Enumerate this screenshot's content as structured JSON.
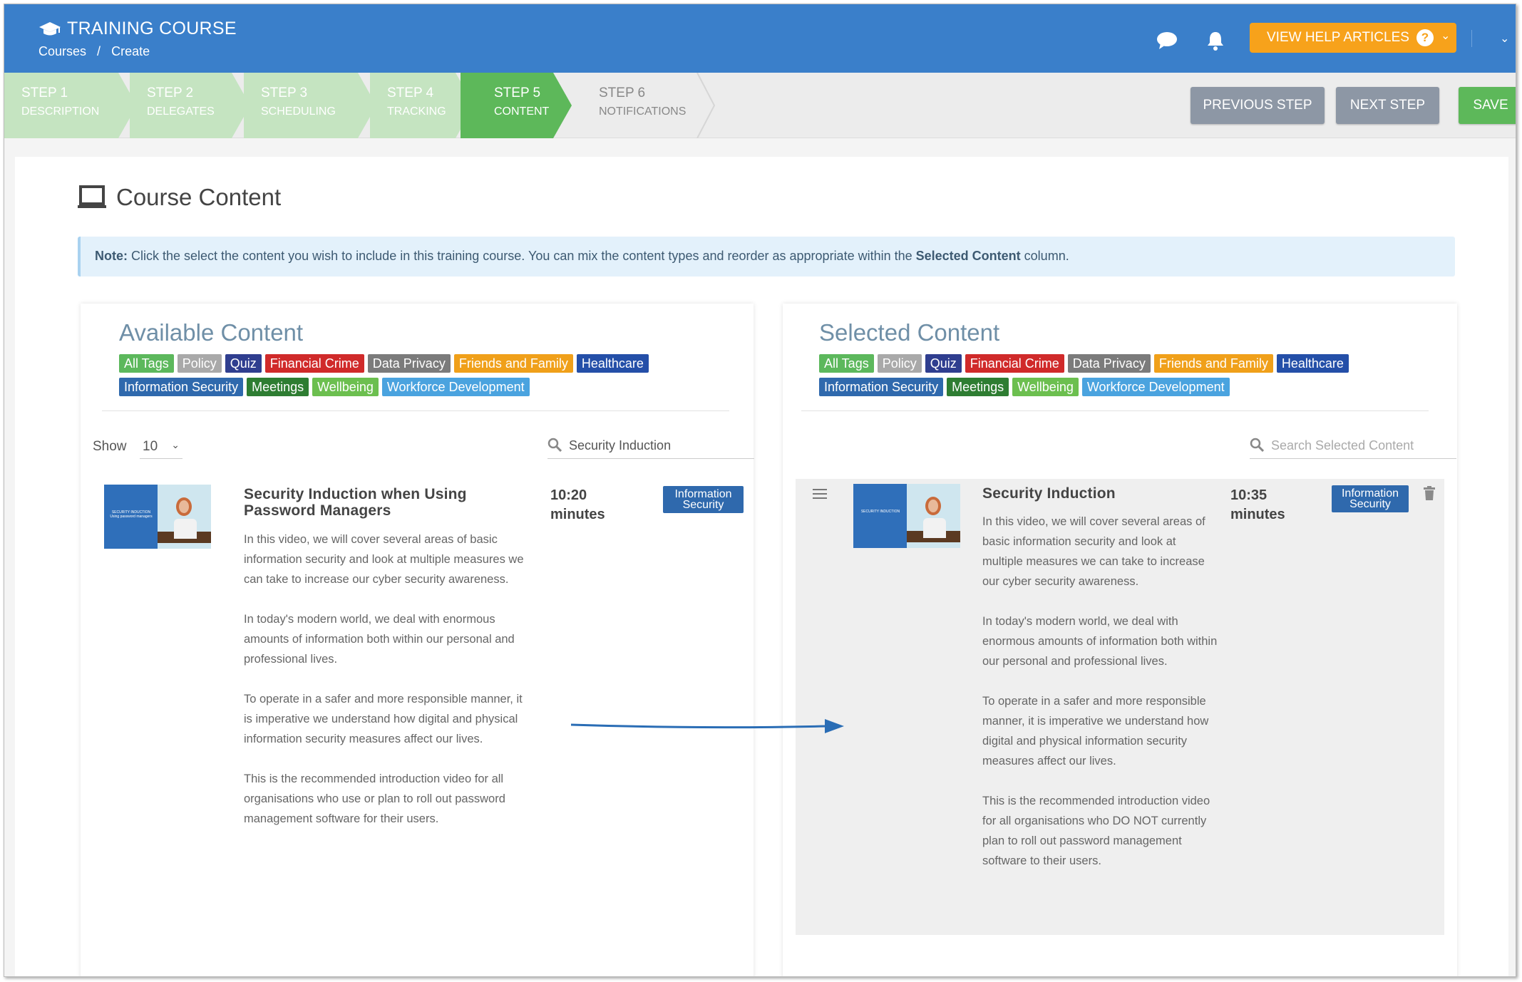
{
  "header": {
    "app_title": "TRAINING COURSE",
    "breadcrumbs": [
      "Courses",
      "/",
      "Create"
    ],
    "help_button": "VIEW HELP ARTICLES",
    "help_q": "?",
    "chevron": "⌄"
  },
  "steps": [
    {
      "num": "STEP 1",
      "label": "DESCRIPTION",
      "state": "done"
    },
    {
      "num": "STEP 2",
      "label": "DELEGATES",
      "state": "done"
    },
    {
      "num": "STEP 3",
      "label": "SCHEDULING",
      "state": "done"
    },
    {
      "num": "STEP 4",
      "label": "TRACKING",
      "state": "done"
    },
    {
      "num": "STEP 5",
      "label": "CONTENT",
      "state": "active"
    },
    {
      "num": "STEP 6",
      "label": "NOTIFICATIONS",
      "state": "todo"
    }
  ],
  "actions": {
    "previous": "PREVIOUS STEP",
    "next": "NEXT STEP",
    "save": "SAVE"
  },
  "page": {
    "title": "Course Content",
    "note_label": "Note:",
    "note_text": " Click the select the content you wish to include in this training course. You can mix the content types and reorder as appropriate within the ",
    "note_bold": "Selected Content",
    "note_end": " column."
  },
  "tags": [
    {
      "label": "All Tags",
      "color": "#5cb85c"
    },
    {
      "label": "Policy",
      "color": "#a9a9a9"
    },
    {
      "label": "Quiz",
      "color": "#2f3e8f"
    },
    {
      "label": "Financial Crime",
      "color": "#d02a2a"
    },
    {
      "label": "Data Privacy",
      "color": "#7b7b7b"
    },
    {
      "label": "Friends and Family",
      "color": "#f0a01a"
    },
    {
      "label": "Healthcare",
      "color": "#244fa8"
    },
    {
      "label": "Information Security",
      "color": "#2f69ad"
    },
    {
      "label": "Meetings",
      "color": "#2e7d32"
    },
    {
      "label": "Wellbeing",
      "color": "#6cbf4f"
    },
    {
      "label": "Workforce Development",
      "color": "#4aa3df"
    }
  ],
  "available": {
    "title": "Available Content",
    "show_label": "Show",
    "show_value": "10",
    "search_value": "Security Induction",
    "item": {
      "title": "Security Induction when Using Password Managers",
      "duration_num": "10:20",
      "duration_unit": "minutes",
      "tag": "Information Security",
      "thumb_text": "SECURITY INDUCTION Using password managers",
      "desc": [
        "In this video, we will cover several areas of basic information security and look at multiple measures we can take to increase our cyber security awareness.",
        "In today's modern world, we deal with enormous amounts of information both within our personal and professional lives.",
        "To operate in a safer and more responsible manner, it is imperative we understand how digital and physical information security measures affect our lives.",
        "This is the recommended introduction video for all organisations who use or plan to roll out password management software for their users."
      ]
    }
  },
  "selected": {
    "title": "Selected Content",
    "search_placeholder": "Search Selected Content",
    "item": {
      "title": "Security Induction",
      "duration_num": "10:35",
      "duration_unit": "minutes",
      "tag": "Information Security",
      "thumb_text": "SECURITY INDUCTION",
      "desc": [
        "In this video, we will cover several areas of basic information security and look at multiple measures we can take to increase our cyber security awareness.",
        "In today's modern world, we deal with enormous amounts of information both within our personal and professional lives.",
        "To operate in a safer and more responsible manner, it is imperative we understand how digital and physical information security measures affect our lives.",
        "This is the recommended introduction video for all organisations who DO NOT currently plan to roll out password management software to their users."
      ]
    }
  },
  "colors": {
    "brand": "#3a7fca",
    "help": "#f7a21b",
    "step_done": "#c5e4c1",
    "step_active": "#5db85a",
    "save": "#5db85a",
    "nav_btn": "#8d97a5"
  }
}
